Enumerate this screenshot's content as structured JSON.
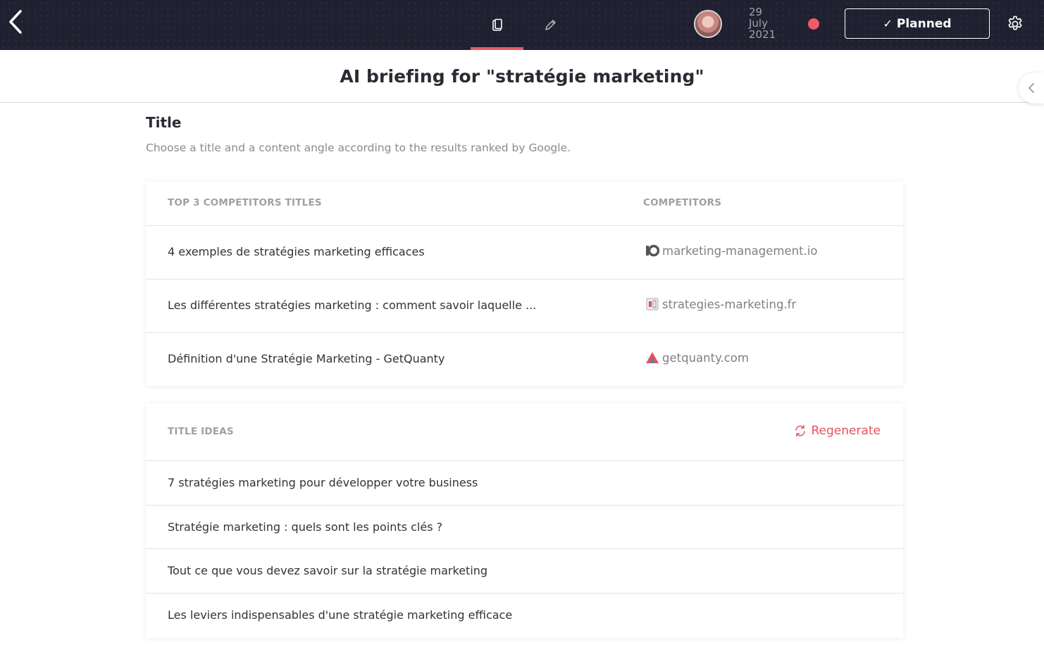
{
  "topbar": {
    "date_day": "29",
    "date_month": "July",
    "date_year": "2021",
    "status_label": "Planned",
    "status_check": "✓",
    "accent_color": "#e85a66"
  },
  "header": {
    "title": "AI briefing for \"stratégie marketing\""
  },
  "section": {
    "title": "Title",
    "description": "Choose a title and a content angle according to the results ranked by Google."
  },
  "competitors": {
    "header_titles": "TOP 3 COMPETITORS TITLES",
    "header_sites": "COMPETITORS",
    "rows": [
      {
        "title": "4 exemples de stratégies marketing efficaces",
        "site": "marketing-management.io",
        "icon": "marketing-management-favicon"
      },
      {
        "title": "Les différentes stratégies marketing : comment savoir laquelle ...",
        "site": "strategies-marketing.fr",
        "icon": "strategies-marketing-favicon"
      },
      {
        "title": "Définition d'une Stratégie Marketing - GetQuanty",
        "site": "getquanty.com",
        "icon": "getquanty-favicon"
      }
    ]
  },
  "ideas": {
    "header": "TITLE IDEAS",
    "regenerate_label": "Regenerate",
    "items": [
      "7 stratégies marketing pour développer votre business",
      "Stratégie marketing : quels sont les points clés ?",
      "Tout ce que vous devez savoir sur la stratégie marketing",
      "Les leviers indispensables d'une stratégie marketing efficace"
    ]
  }
}
